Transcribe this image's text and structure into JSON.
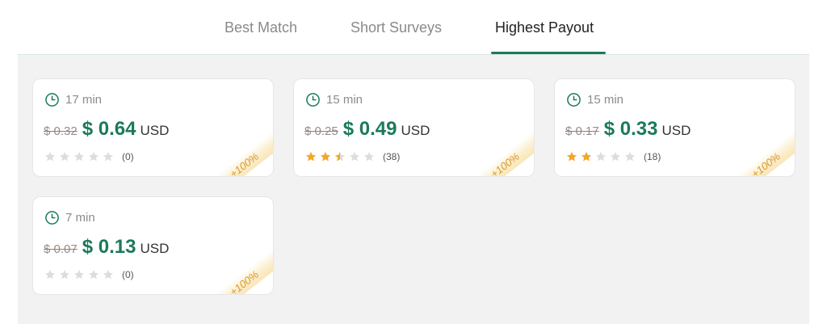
{
  "tabs": [
    {
      "label": "Best Match",
      "active": false
    },
    {
      "label": "Short Surveys",
      "active": false
    },
    {
      "label": "Highest Payout",
      "active": true
    }
  ],
  "colors": {
    "accent": "#1b7a5a",
    "star_filled": "#f5a623",
    "star_empty": "#dddddd",
    "bonus": "#d89a2b"
  },
  "surveys": [
    {
      "duration": "17 min",
      "old_price": "$ 0.32",
      "price": "$ 0.64",
      "currency": "USD",
      "rating": 0,
      "rating_count": "(0)",
      "bonus": "+100%"
    },
    {
      "duration": "15 min",
      "old_price": "$ 0.25",
      "price": "$ 0.49",
      "currency": "USD",
      "rating": 2.5,
      "rating_count": "(38)",
      "bonus": "+100%"
    },
    {
      "duration": "15 min",
      "old_price": "$ 0.17",
      "price": "$ 0.33",
      "currency": "USD",
      "rating": 2,
      "rating_count": "(18)",
      "bonus": "+100%"
    },
    {
      "duration": "7 min",
      "old_price": "$ 0.07",
      "price": "$ 0.13",
      "currency": "USD",
      "rating": 0,
      "rating_count": "(0)",
      "bonus": "+100%"
    }
  ]
}
